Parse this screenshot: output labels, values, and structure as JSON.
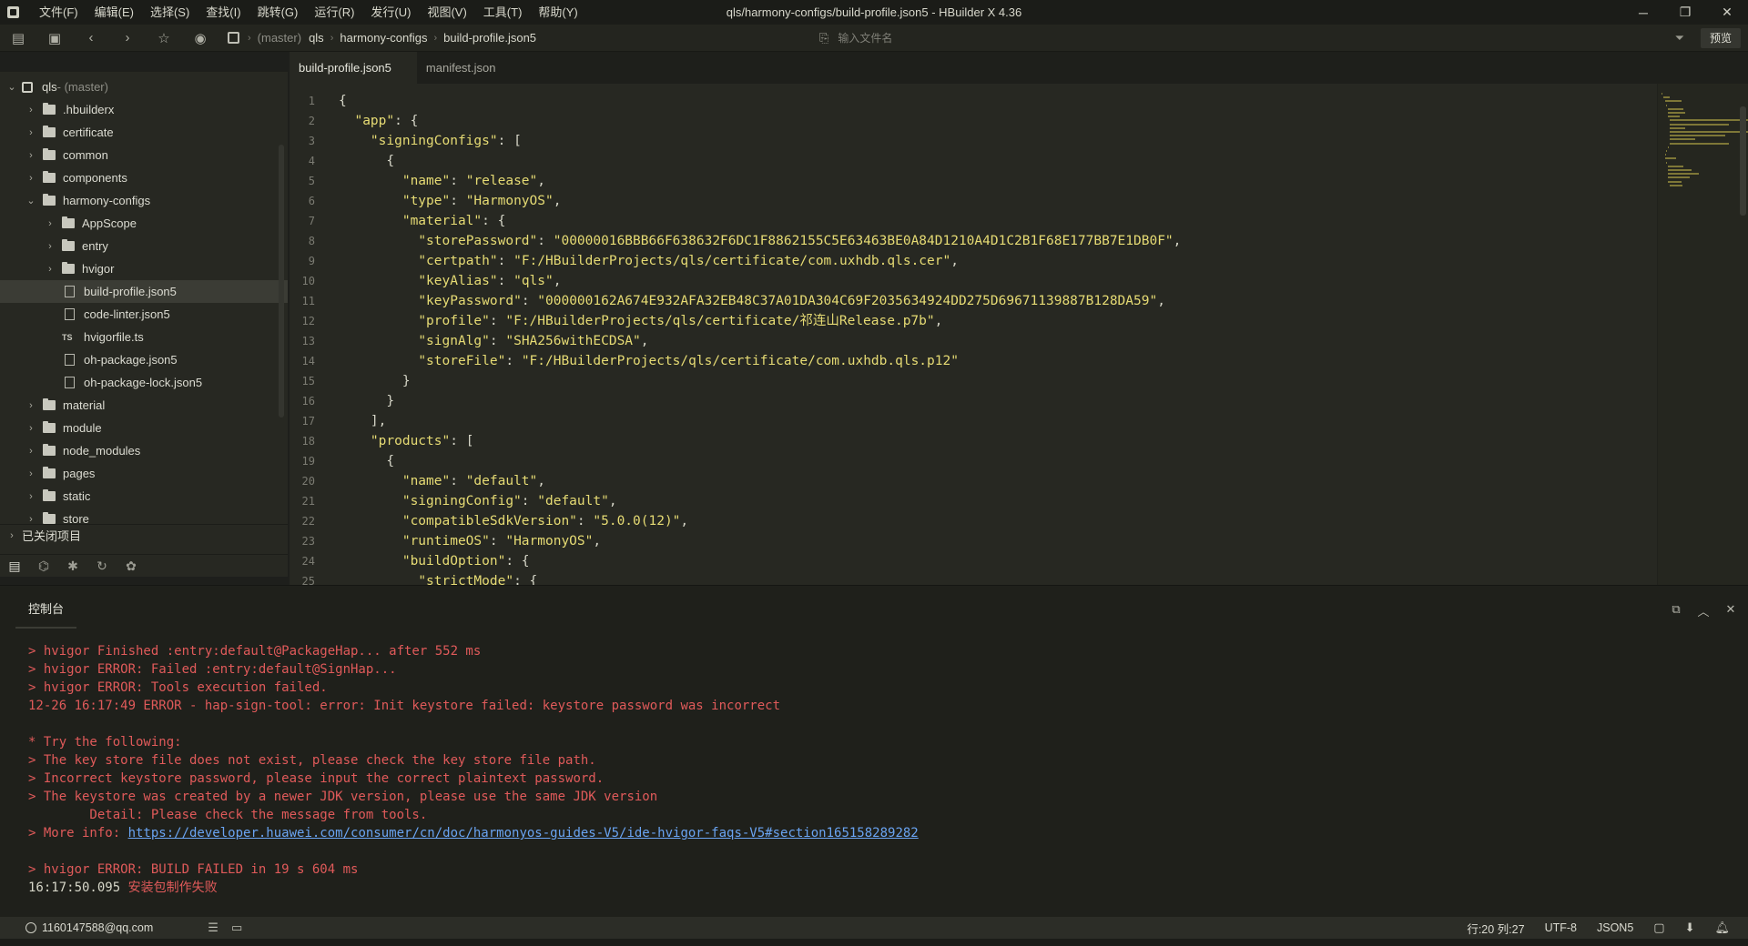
{
  "window": {
    "title": "qls/harmony-configs/build-profile.json5 - HBuilder X 4.36",
    "menu": [
      "文件(F)",
      "编辑(E)",
      "选择(S)",
      "查找(I)",
      "跳转(G)",
      "运行(R)",
      "发行(U)",
      "视图(V)",
      "工具(T)",
      "帮助(Y)"
    ],
    "controls": {
      "minimize": "─",
      "restore": "❐",
      "close": "✕"
    }
  },
  "toolbar": {
    "breadcrumb": {
      "branch": "(master)",
      "items": [
        "qls",
        "harmony-configs",
        "build-profile.json5"
      ]
    },
    "file_search_placeholder": "输入文件名",
    "preview_label": "预览"
  },
  "sidebar": {
    "tree": [
      {
        "label": "qls",
        "suffix": " - (master)",
        "depth": 0,
        "kind": "project",
        "expanded": true
      },
      {
        "label": ".hbuilderx",
        "depth": 1,
        "kind": "folder",
        "expanded": false
      },
      {
        "label": "certificate",
        "depth": 1,
        "kind": "folder",
        "expanded": false
      },
      {
        "label": "common",
        "depth": 1,
        "kind": "folder",
        "expanded": false
      },
      {
        "label": "components",
        "depth": 1,
        "kind": "folder",
        "expanded": false
      },
      {
        "label": "harmony-configs",
        "depth": 1,
        "kind": "folder",
        "expanded": true
      },
      {
        "label": "AppScope",
        "depth": 2,
        "kind": "folder",
        "expanded": false
      },
      {
        "label": "entry",
        "depth": 2,
        "kind": "folder",
        "expanded": false
      },
      {
        "label": "hvigor",
        "depth": 2,
        "kind": "folder",
        "expanded": false
      },
      {
        "label": "build-profile.json5",
        "depth": 2,
        "kind": "file",
        "selected": true
      },
      {
        "label": "code-linter.json5",
        "depth": 2,
        "kind": "file"
      },
      {
        "label": "hvigorfile.ts",
        "depth": 2,
        "kind": "ts"
      },
      {
        "label": "oh-package.json5",
        "depth": 2,
        "kind": "file"
      },
      {
        "label": "oh-package-lock.json5",
        "depth": 2,
        "kind": "file"
      },
      {
        "label": "material",
        "depth": 1,
        "kind": "folder",
        "expanded": false
      },
      {
        "label": "module",
        "depth": 1,
        "kind": "folder",
        "expanded": false
      },
      {
        "label": "node_modules",
        "depth": 1,
        "kind": "folder",
        "expanded": false
      },
      {
        "label": "pages",
        "depth": 1,
        "kind": "folder",
        "expanded": false
      },
      {
        "label": "static",
        "depth": 1,
        "kind": "folder",
        "expanded": false
      },
      {
        "label": "store",
        "depth": 1,
        "kind": "folder",
        "expanded": false
      }
    ],
    "closed_projects_label": "已关闭项目"
  },
  "editor": {
    "tabs": [
      {
        "label": "build-profile.json5",
        "active": true
      },
      {
        "label": "manifest.json",
        "active": false
      }
    ],
    "lines": [
      "{",
      "  \"app\": {",
      "    \"signingConfigs\": [",
      "      {",
      "        \"name\": \"release\",",
      "        \"type\": \"HarmonyOS\",",
      "        \"material\": {",
      "          \"storePassword\": \"00000016BBB66F638632F6DC1F8862155C5E63463BE0A84D1210A4D1C2B1F68E177BB7E1DB0F\",",
      "          \"certpath\": \"F:/HBuilderProjects/qls/certificate/com.uxhdb.qls.cer\",",
      "          \"keyAlias\": \"qls\",",
      "          \"keyPassword\": \"000000162A674E932AFA32EB48C37A01DA304C69F2035634924DD275D69671139887B128DA59\",",
      "          \"profile\": \"F:/HBuilderProjects/qls/certificate/祁连山Release.p7b\",",
      "          \"signAlg\": \"SHA256withECDSA\",",
      "          \"storeFile\": \"F:/HBuilderProjects/qls/certificate/com.uxhdb.qls.p12\"",
      "        }",
      "      }",
      "    ],",
      "    \"products\": [",
      "      {",
      "        \"name\": \"default\",",
      "        \"signingConfig\": \"default\",",
      "        \"compatibleSdkVersion\": \"5.0.0(12)\",",
      "        \"runtimeOS\": \"HarmonyOS\",",
      "        \"buildOption\": {",
      "          \"strictMode\": {"
    ]
  },
  "console": {
    "tab_label": "控制台",
    "lines": [
      {
        "text": "> hvigor Finished :entry:default@PackageHap... after 552 ms"
      },
      {
        "text": "> hvigor ERROR: Failed :entry:default@SignHap..."
      },
      {
        "text": "> hvigor ERROR: Tools execution failed."
      },
      {
        "text": "12-26 16:17:49 ERROR - hap-sign-tool: error: Init keystore failed: keystore password was incorrect"
      },
      {
        "text": ""
      },
      {
        "text": "* Try the following:"
      },
      {
        "text": "> The key store file does not exist, please check the key store file path."
      },
      {
        "text": "> Incorrect keystore password, please input the correct plaintext password."
      },
      {
        "text": "> The keystore was created by a newer JDK version, please use the same JDK version"
      },
      {
        "text": "        Detail: Please check the message from tools."
      },
      {
        "text": "> More info: ",
        "link": "https://developer.huawei.com/consumer/cn/doc/harmonyos-guides-V5/ide-hvigor-faqs-V5#section165158289282"
      },
      {
        "text": ""
      },
      {
        "text": "> hvigor ERROR: BUILD FAILED in 19 s 604 ms"
      },
      {
        "time": "16:17:50.095 ",
        "text": "安装包制作失败"
      }
    ]
  },
  "statusbar": {
    "user": "1160147588@qq.com",
    "cursor": "行:20  列:27",
    "encoding": "UTF-8",
    "language": "JSON5"
  }
}
